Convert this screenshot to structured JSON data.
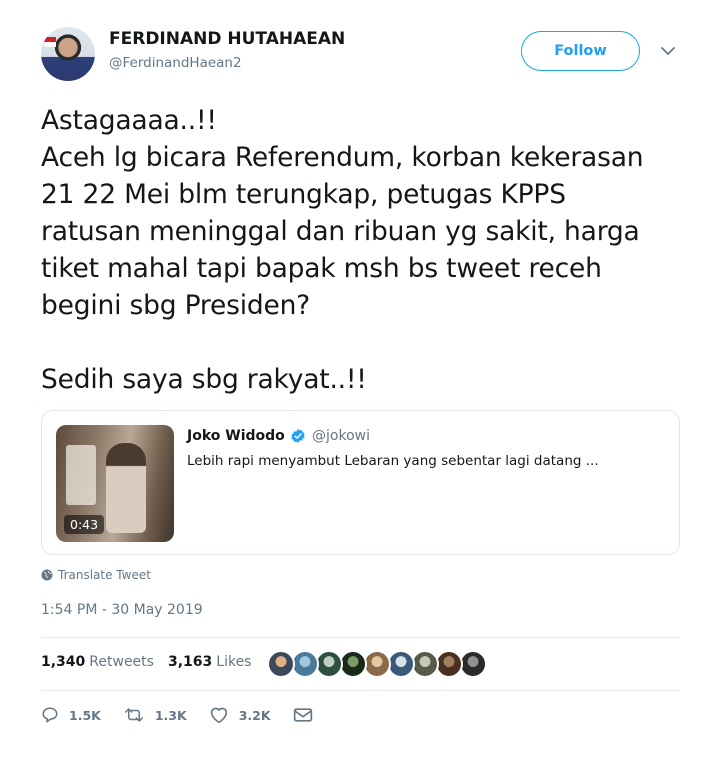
{
  "author": {
    "display_name": "FERDINAND HUTAHAEAN",
    "handle": "@FerdinandHaean2"
  },
  "header": {
    "follow_label": "Follow",
    "menu_icon": "chevron-down-icon"
  },
  "tweet": {
    "lines": [
      "Astagaaaa..!!",
      "Aceh lg bicara Referendum, korban kekerasan",
      "21 22 Mei blm terungkap, petugas KPPS",
      "ratusan meninggal dan ribuan yg sakit, harga",
      "tiket mahal tapi bapak msh bs tweet receh",
      "begini sbg Presiden?"
    ],
    "closing": "Sedih saya sbg rakyat..!!"
  },
  "quoted_tweet": {
    "name": "Joko Widodo",
    "handle": "@jokowi",
    "text": "Lebih rapi menyambut Lebaran yang sebentar lagi datang ...",
    "video_duration": "0:43",
    "verified_icon": "verified-badge-icon"
  },
  "translate_label": "Translate Tweet",
  "timestamp": "1:54 PM - 30 May 2019",
  "stats": {
    "retweets_count": "1,340",
    "retweets_label": "Retweets",
    "likes_count": "3,163",
    "likes_label": "Likes"
  },
  "liker_avatars": [
    {
      "color": "#3a4a5a",
      "accent": "#e0b080"
    },
    {
      "color": "#4a7a9a",
      "accent": "#a0c8e0"
    },
    {
      "color": "#2f4f3f",
      "accent": "#c0d0c0"
    },
    {
      "color": "#1a2a1a",
      "accent": "#7a9a6a"
    },
    {
      "color": "#8a6a4a",
      "accent": "#e8c8a0"
    },
    {
      "color": "#3a5a7a",
      "accent": "#d8e0e8"
    },
    {
      "color": "#5a5a4a",
      "accent": "#c8c8b8"
    },
    {
      "color": "#4a3020",
      "accent": "#a08060"
    },
    {
      "color": "#2a2a2a",
      "accent": "#909090"
    }
  ],
  "actions": {
    "replies": "1.5K",
    "retweets": "1.3K",
    "likes": "3.2K"
  },
  "colors": {
    "accent": "#1da1f2",
    "secondary_text": "#657786",
    "border": "#e1e8ed"
  }
}
